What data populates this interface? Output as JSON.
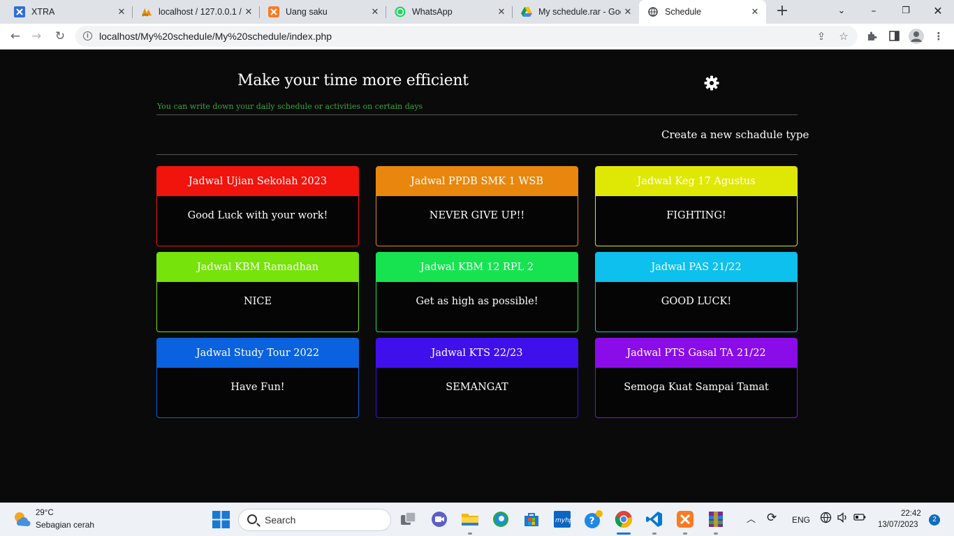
{
  "browser": {
    "tabs": [
      {
        "title": "XTRA",
        "icon": "xtra-icon",
        "active": false
      },
      {
        "title": "localhost / 127.0.0.1 / ",
        "icon": "phpmyadmin-icon",
        "active": false
      },
      {
        "title": "Uang saku",
        "icon": "xampp-icon",
        "active": false
      },
      {
        "title": "WhatsApp",
        "icon": "whatsapp-icon",
        "active": false
      },
      {
        "title": "My schedule.rar - Goo",
        "icon": "google-drive-icon",
        "active": false
      },
      {
        "title": "Schedule",
        "icon": "globe-icon",
        "active": true
      }
    ],
    "url": "localhost/My%20schedule/My%20schedule/index.php"
  },
  "page": {
    "title": "Make your time more efficient",
    "subtitle": "You can write down your daily schedule or activities on certain days",
    "create_label": "Create a new schadule type",
    "accent_color": "#3aa245"
  },
  "cards": [
    {
      "title": "Jadwal Ujian Sekolah 2023",
      "message": "Good Luck with your work!",
      "color": "#f0140c"
    },
    {
      "title": "Jadwal PPDB SMK 1 WSB",
      "message": "NEVER GIVE UP!!",
      "color": "#e8870e"
    },
    {
      "title": "Jadwal Keg 17 Agustus",
      "message": "FIGHTING!",
      "color": "#dfe804"
    },
    {
      "title": "Jadwal KBM Ramadhan",
      "message": "NICE",
      "color": "#76e30a"
    },
    {
      "title": "Jadwal KBM 12 RPL 2",
      "message": "Get as high as possible!",
      "color": "#17e351"
    },
    {
      "title": "Jadwal PAS 21/22",
      "message": "GOOD LUCK!",
      "color": "#0dc0ed"
    },
    {
      "title": "Jadwal Study Tour 2022",
      "message": "Have Fun!",
      "color": "#0a62de"
    },
    {
      "title": "Jadwal KTS 22/23",
      "message": "SEMANGAT",
      "color": "#3f10ec"
    },
    {
      "title": "Jadwal PTS Gasal TA 21/22",
      "message": "Semoga Kuat Sampai Tamat",
      "color": "#8a0ce8"
    }
  ],
  "taskbar": {
    "temperature": "29°C",
    "condition": "Sebagian cerah",
    "search_label": "Search",
    "language": "ENG",
    "time": "22:42",
    "date": "13/07/2023",
    "notifications": "2"
  }
}
